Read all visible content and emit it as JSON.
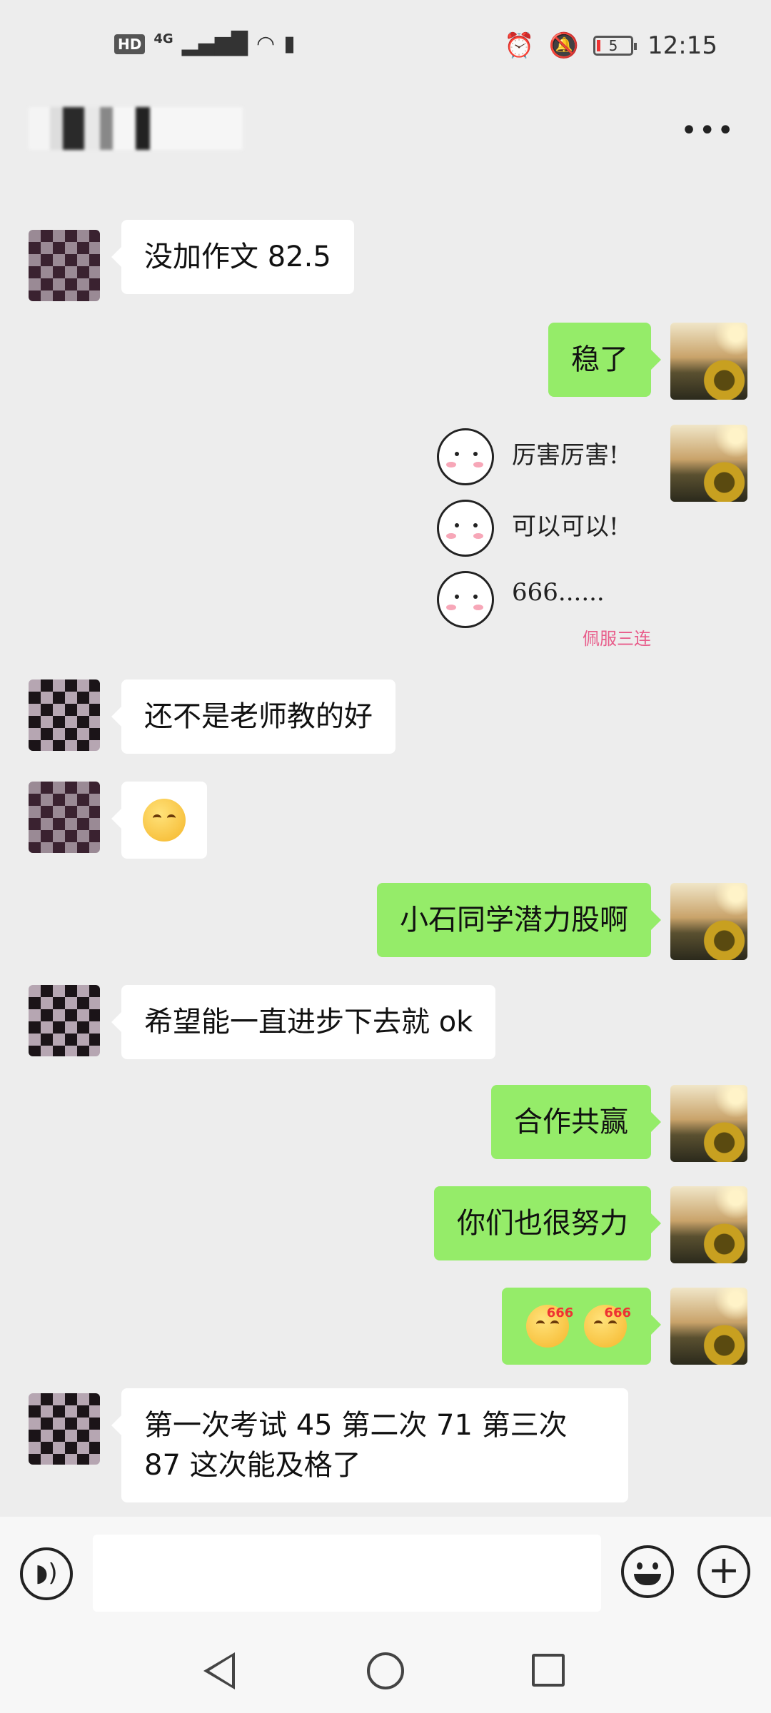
{
  "status_bar": {
    "left_icons": [
      "hd-badge",
      "4g-signal-icon",
      "wifi-icon",
      "battery-saver-icon"
    ],
    "hd_label": "HD",
    "network_label": "4G",
    "battery_level": "5",
    "time": "12:15"
  },
  "header": {
    "contact_name": "▮▯▮",
    "more_label": "•••"
  },
  "messages": [
    {
      "side": "in",
      "text": "没加作文 82.5"
    },
    {
      "side": "out",
      "text": "稳了"
    },
    {
      "side": "out",
      "type": "sticker",
      "lines": [
        "厉害厉害!",
        "可以可以!",
        "666......"
      ],
      "caption": "佩服三连"
    },
    {
      "side": "in",
      "text": "还不是老师教的好"
    },
    {
      "side": "in",
      "type": "emoji",
      "emoji": "smirk-thinking-emoji"
    },
    {
      "side": "out",
      "text": "小石同学潜力股啊"
    },
    {
      "side": "in",
      "text": "希望能一直进步下去就 ok"
    },
    {
      "side": "out",
      "text": "合作共赢"
    },
    {
      "side": "out",
      "text": "你们也很努力"
    },
    {
      "side": "out",
      "type": "emoji",
      "emoji": "666-emoji",
      "tag": "666"
    },
    {
      "side": "in",
      "text": "第一次考试 45 第二次 71 第三次 87 这次能及格了"
    }
  ],
  "input_bar": {
    "placeholder": "",
    "voice_icon": "voice-icon",
    "plus_label": "+"
  },
  "colors": {
    "background": "#ededed",
    "outgoing_bubble": "#95ec69",
    "incoming_bubble": "#ffffff"
  }
}
